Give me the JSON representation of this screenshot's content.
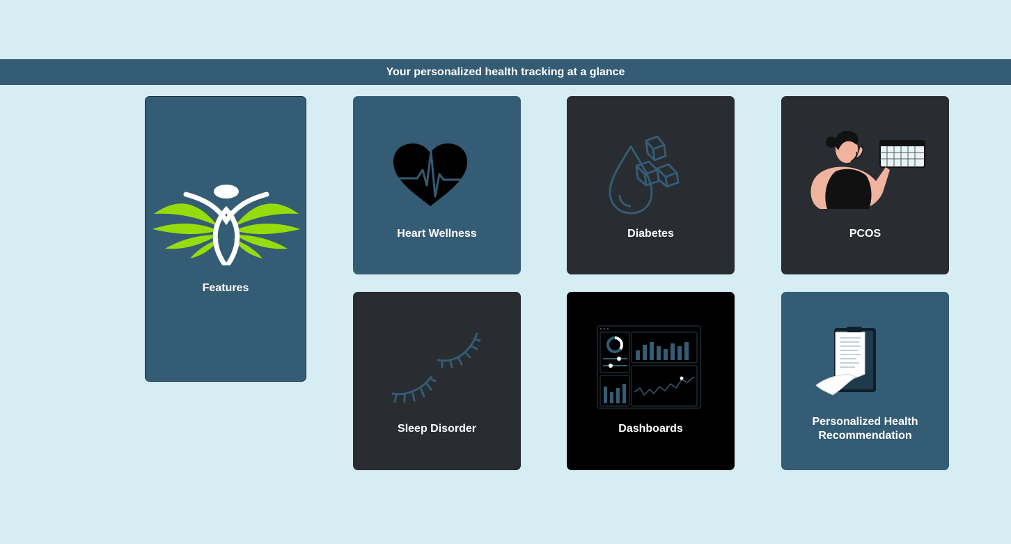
{
  "banner": {
    "text": "Your personalized health tracking at a glance"
  },
  "cards": {
    "features": {
      "label": "Features",
      "icon": "wellness-logo-icon"
    },
    "heart": {
      "label": "Heart Wellness",
      "icon": "heartbeat-icon"
    },
    "diabetes": {
      "label": "Diabetes",
      "icon": "blood-sugar-icon"
    },
    "pcos": {
      "label": "PCOS",
      "icon": "woman-calendar-icon"
    },
    "sleep": {
      "label": "Sleep Disorder",
      "icon": "closed-eyes-icon"
    },
    "dashboards": {
      "label": "Dashboards",
      "icon": "dashboard-icon"
    },
    "recommendation": {
      "label": "Personalized Health Recommendation",
      "icon": "report-document-icon"
    }
  },
  "colors": {
    "background": "#d6edf4",
    "banner": "#345c74",
    "card_blue": "#345c74",
    "card_dark": "#292c30",
    "card_black": "#000000",
    "leaf_green": "#8fd400"
  }
}
